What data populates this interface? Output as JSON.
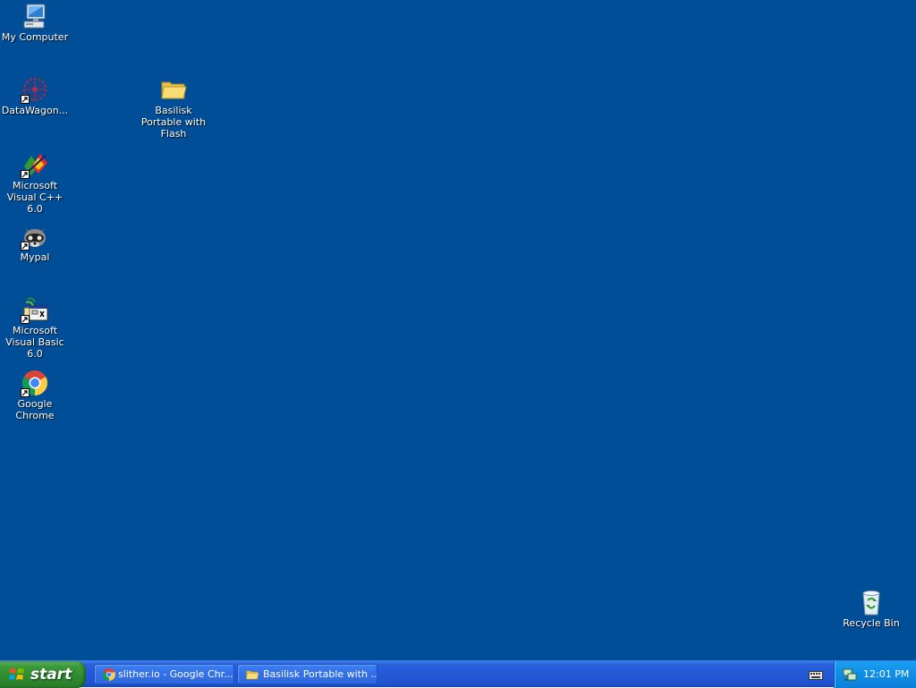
{
  "desktop": {
    "background_color": "#004e98",
    "icons": [
      {
        "label": "My Computer",
        "icon": "my-computer-icon",
        "shortcut": false
      },
      {
        "label": "DataWagon...",
        "icon": "datawagon-icon",
        "shortcut": true
      },
      {
        "label": "Microsoft Visual C++ 6.0",
        "icon": "visual-cpp-icon",
        "shortcut": true
      },
      {
        "label": "Mypal",
        "icon": "mypal-icon",
        "shortcut": true
      },
      {
        "label": "Microsoft Visual Basic 6.0",
        "icon": "visual-basic-icon",
        "shortcut": true
      },
      {
        "label": "Google Chrome",
        "icon": "chrome-icon",
        "shortcut": true
      },
      {
        "label": "Basilisk Portable with Flash",
        "icon": "folder-icon",
        "shortcut": false
      },
      {
        "label": "Recycle Bin",
        "icon": "recycle-bin-icon",
        "shortcut": false
      }
    ]
  },
  "taskbar": {
    "start_label": "start",
    "tasks": [
      {
        "label": "slither.io - Google Chr...",
        "icon": "chrome-icon"
      },
      {
        "label": "Basilisk Portable with ...",
        "icon": "folder-icon"
      }
    ],
    "tray": {
      "icons": [
        "keyboard-icon",
        "network-icon"
      ],
      "clock": "12:01 PM"
    }
  },
  "colors": {
    "taskbar": "#2458d6",
    "start_button": "#3b9a3a",
    "tray": "#0f8de6"
  }
}
